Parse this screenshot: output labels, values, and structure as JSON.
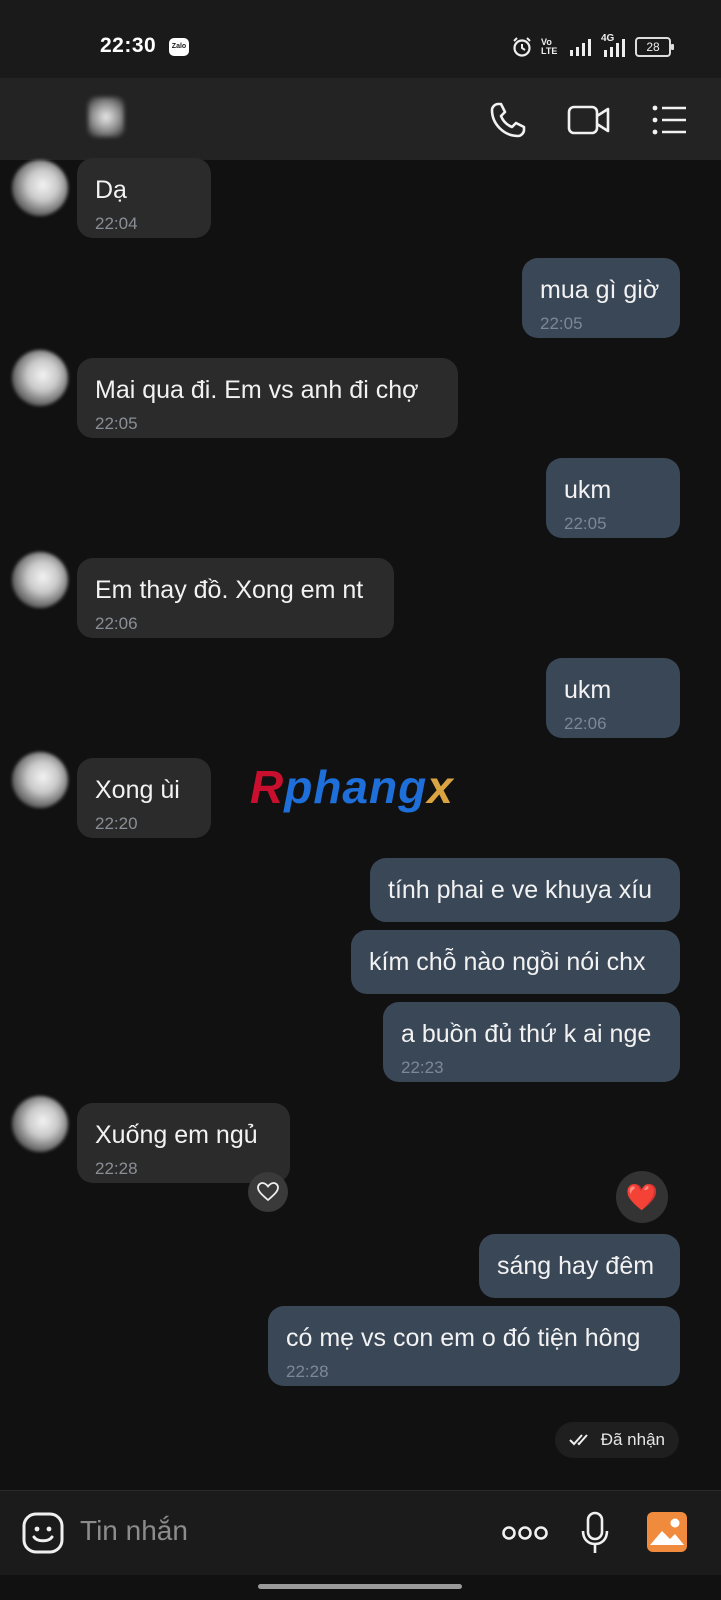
{
  "status_bar": {
    "time": "22:30",
    "app_badge": "Zalo",
    "volte": "Vo LTE",
    "network": "4G",
    "battery": "28",
    "icons": [
      "alarm-icon",
      "volte-icon",
      "signal-icon",
      "4g-signal-icon",
      "battery-icon"
    ]
  },
  "header": {
    "icons": [
      "phone-call-icon",
      "video-call-icon",
      "menu-list-icon"
    ]
  },
  "messages": [
    {
      "dir": "received",
      "text": "Dạ",
      "time": "22:04"
    },
    {
      "dir": "sent",
      "text": "mua gì giờ",
      "time": "22:05"
    },
    {
      "dir": "received",
      "text": "Mai qua đi. Em vs anh đi chợ",
      "time": "22:05"
    },
    {
      "dir": "sent",
      "text": "ukm",
      "time": "22:05"
    },
    {
      "dir": "received",
      "text": "Em thay đồ. Xong em nt",
      "time": "22:06"
    },
    {
      "dir": "sent",
      "text": "ukm",
      "time": "22:06"
    },
    {
      "dir": "received",
      "text": "Xong ùi",
      "time": "22:20"
    },
    {
      "dir": "sent",
      "text": "tính phai e ve khuya xíu",
      "time": ""
    },
    {
      "dir": "sent",
      "text": "kím chỗ nào ngồi nói chx",
      "time": ""
    },
    {
      "dir": "sent",
      "text": "a buồn đủ thứ k ai nge",
      "time": "22:23"
    },
    {
      "dir": "received",
      "text": "Xuống em ngủ",
      "time": "22:28"
    },
    {
      "dir": "sent",
      "text": "sáng hay đêm",
      "time": ""
    },
    {
      "dir": "sent",
      "text": "có mẹ vs con em o đó tiện hông",
      "time": "22:28"
    }
  ],
  "watermark": {
    "part1": "R",
    "part2": "phang",
    "part3": "x"
  },
  "delivery_status": "Đã nhận",
  "reaction": {
    "heart": "❤️"
  },
  "input": {
    "placeholder": "Tin nhắn"
  },
  "colors": {
    "sent_bubble": "#3a4757",
    "received_bubble": "#2b2b2b",
    "background": "#111111",
    "gallery_accent": "#f08a3c"
  }
}
